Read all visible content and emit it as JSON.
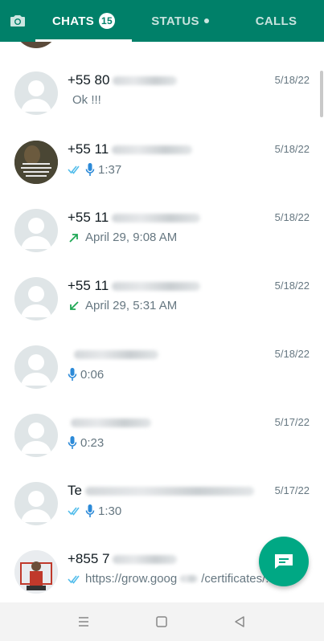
{
  "header": {
    "tabs": [
      {
        "label": "CHATS",
        "badge": "15",
        "active": true
      },
      {
        "label": "STATUS",
        "active": false
      },
      {
        "label": "CALLS",
        "active": false
      }
    ],
    "background": "#008069"
  },
  "chats": [
    {
      "name": "+55  80",
      "date": "5/18/22",
      "preview": "Ok !!!",
      "status": "none"
    },
    {
      "name": "+55 11",
      "date": "5/18/22",
      "preview": "1:37",
      "status": "voice-read"
    },
    {
      "name": "+55 11",
      "date": "5/18/22",
      "preview": "April 29, 9:08 AM",
      "status": "call-outgoing"
    },
    {
      "name": "+55 11",
      "date": "5/18/22",
      "preview": "April 29, 5:31 AM",
      "status": "call-incoming"
    },
    {
      "name": "",
      "date": "5/18/22",
      "preview": "0:06",
      "status": "voice"
    },
    {
      "name": "",
      "date": "5/17/22",
      "preview": "0:23",
      "status": "voice"
    },
    {
      "name": "Te",
      "date": "5/17/22",
      "preview": "1:30",
      "status": "voice-read"
    },
    {
      "name": "+855 7",
      "date": "",
      "preview": "https://grow.goog",
      "preview_tail": "/certificates/...",
      "status": "link-read"
    }
  ],
  "fab": {
    "icon": "new-chat-icon",
    "color": "#00a884"
  },
  "navigation": {
    "items": [
      "menu-icon",
      "home-icon",
      "back-icon"
    ]
  }
}
